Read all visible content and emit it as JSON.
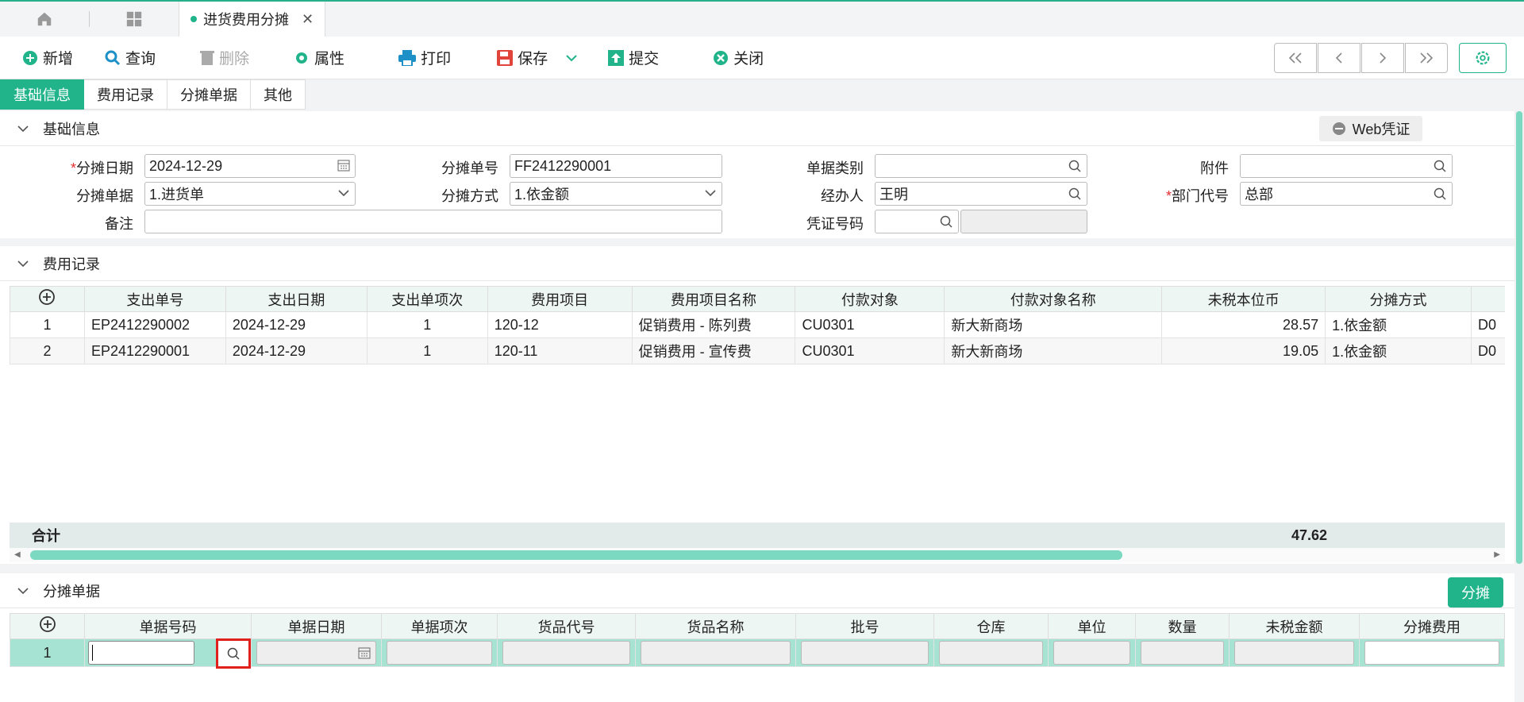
{
  "topbar": {
    "tab_title": "进货费用分摊"
  },
  "toolbar": {
    "new": "新增",
    "query": "查询",
    "delete": "删除",
    "props": "属性",
    "print": "打印",
    "save": "保存",
    "submit": "提交",
    "close": "关闭"
  },
  "tabs": [
    "基础信息",
    "费用记录",
    "分摊单据",
    "其他"
  ],
  "basic": {
    "title": "基础信息",
    "web_voucher": "Web凭证",
    "date_label": "分摊日期",
    "date_value": "2024-12-29",
    "no_label": "分摊单号",
    "no_value": "FF2412290001",
    "type_label": "单据类别",
    "type_value": "",
    "attach_label": "附件",
    "attach_value": "",
    "doc_label": "分摊单据",
    "doc_value": "1.进货单",
    "method_label": "分摊方式",
    "method_value": "1.依金额",
    "handler_label": "经办人",
    "handler_value": "王明",
    "dept_label": "部门代号",
    "dept_value": "总部",
    "remark_label": "备注",
    "remark_value": "",
    "voucher_label": "凭证号码",
    "voucher_value": ""
  },
  "expense": {
    "title": "费用记录",
    "columns": [
      "支出单号",
      "支出日期",
      "支出单项次",
      "费用项目",
      "费用项目名称",
      "付款对象",
      "付款对象名称",
      "未税本位币",
      "分摊方式"
    ],
    "rows": [
      {
        "n": "1",
        "no": "EP2412290002",
        "date": "2024-12-29",
        "seq": "1",
        "item": "120-12",
        "item_name": "促销费用 - 陈列费",
        "payee": "CU0301",
        "payee_name": "新大新商场",
        "amount": "28.57",
        "method": "1.依金额",
        "extra": "D0"
      },
      {
        "n": "2",
        "no": "EP2412290001",
        "date": "2024-12-29",
        "seq": "1",
        "item": "120-11",
        "item_name": "促销费用 - 宣传费",
        "payee": "CU0301",
        "payee_name": "新大新商场",
        "amount": "19.05",
        "method": "1.依金额",
        "extra": "D0"
      }
    ],
    "total_label": "合计",
    "total_value": "47.62"
  },
  "alloc": {
    "title": "分摊单据",
    "button": "分摊",
    "columns": [
      "单据号码",
      "单据日期",
      "单据项次",
      "货品代号",
      "货品名称",
      "批号",
      "仓库",
      "单位",
      "数量",
      "未税金额",
      "分摊费用"
    ],
    "row_no": "1"
  }
}
